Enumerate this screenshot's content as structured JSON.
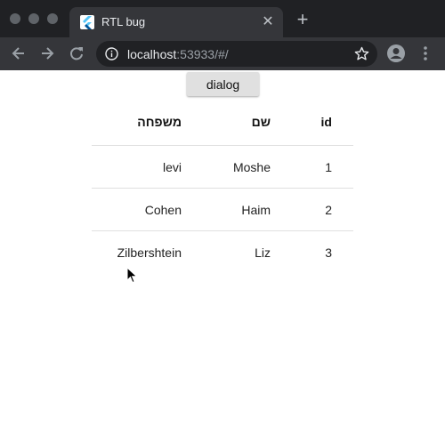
{
  "browser": {
    "tab_title": "RTL bug",
    "tab_close": "✕",
    "new_tab": "+",
    "url_host": "localhost",
    "url_rest": ":53933/#/"
  },
  "page": {
    "dialog_button": "dialog",
    "table": {
      "headers": {
        "id": "id",
        "name": "שם",
        "family": "משפחה"
      },
      "rows": [
        {
          "id": "1",
          "name": "Moshe",
          "family": "levi"
        },
        {
          "id": "2",
          "name": "Haim",
          "family": "Cohen"
        },
        {
          "id": "3",
          "name": "Liz",
          "family": "Zilbershtein"
        }
      ]
    }
  },
  "colors": {
    "chrome_dark": "#202124",
    "chrome_toolbar": "#35363a",
    "divider": "#e0e0e0",
    "button_bg": "#e0e0e0",
    "flutter_blue": "#54c5f8"
  }
}
